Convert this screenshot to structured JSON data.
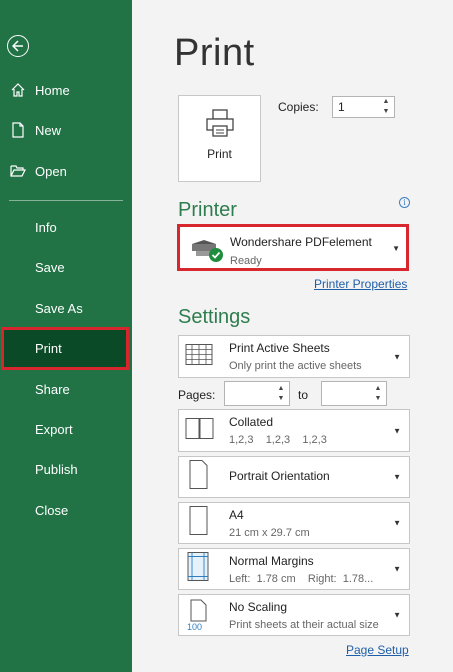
{
  "sidebar": {
    "back_icon": "back-arrow-icon",
    "items": [
      {
        "label": "Home",
        "icon": "home-icon"
      },
      {
        "label": "New",
        "icon": "new-document-icon"
      },
      {
        "label": "Open",
        "icon": "folder-open-icon"
      },
      {
        "label": "Info"
      },
      {
        "label": "Save"
      },
      {
        "label": "Save As"
      },
      {
        "label": "Print",
        "selected": true
      },
      {
        "label": "Share"
      },
      {
        "label": "Export"
      },
      {
        "label": "Publish"
      },
      {
        "label": "Close"
      }
    ],
    "bg_color": "#217346",
    "selected_bg": "#0b4a26",
    "highlight_color": "#d7262d"
  },
  "main": {
    "title": "Print",
    "print_button_label": "Print",
    "copies_label": "Copies:",
    "copies_value": "1",
    "printer_heading": "Printer",
    "printer": {
      "name": "Wondershare PDFelement",
      "status": "Ready"
    },
    "printer_properties_link": "Printer Properties",
    "settings_heading": "Settings",
    "settings": [
      {
        "title": "Print Active Sheets",
        "subtitle": "Only print the active sheets",
        "icon": "sheets-grid-icon"
      },
      {
        "title": "Collated",
        "subtitle": "1,2,3    1,2,3    1,2,3",
        "icon": "collated-icon"
      },
      {
        "title": "Portrait Orientation",
        "subtitle": "",
        "icon": "portrait-icon"
      },
      {
        "title": "A4",
        "subtitle": "21 cm x 29.7 cm",
        "icon": "paper-size-icon"
      },
      {
        "title": "Normal Margins",
        "subtitle": "Left:  1.78 cm    Right:  1.78...",
        "icon": "margins-icon"
      },
      {
        "title": "No Scaling",
        "subtitle": "Print sheets at their actual size",
        "icon": "scaling-icon",
        "icon_text": "100"
      }
    ],
    "pages_label": "Pages:",
    "to_label": "to",
    "pages_from": "",
    "pages_to": "",
    "page_setup_link": "Page Setup",
    "accent_color": "#2e7d4f"
  }
}
